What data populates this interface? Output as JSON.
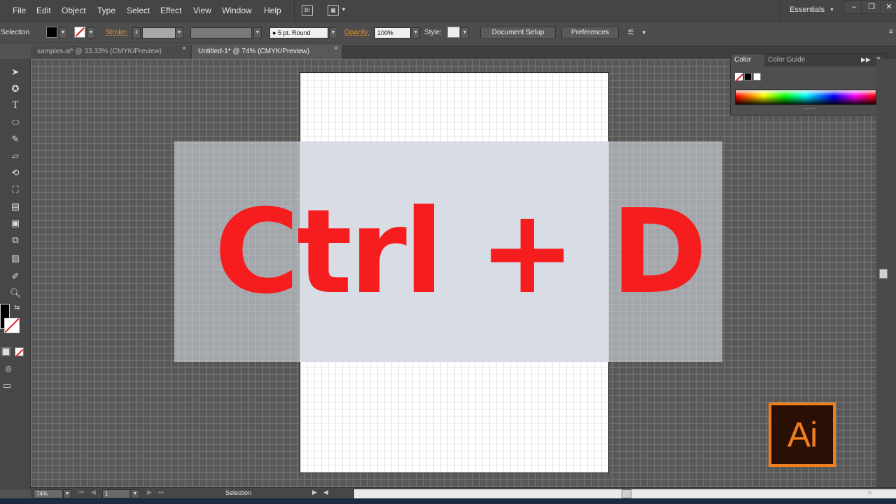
{
  "menu": {
    "items": [
      "File",
      "Edit",
      "Object",
      "Type",
      "Select",
      "Effect",
      "View",
      "Window",
      "Help"
    ],
    "workspace_label": "Essentials",
    "bridge_icon": "Br"
  },
  "control_bar": {
    "selection_label": "Selection",
    "stroke_label": "Stroke:",
    "brush_value": "5 pt. Round",
    "opacity_label": "Opacity:",
    "opacity_value": "100%",
    "style_label": "Style:",
    "document_setup_label": "Document Setup",
    "preferences_label": "Preferences"
  },
  "tabs": [
    {
      "label": "samples.ai* @ 33.33% (CMYK/Preview)",
      "active": false
    },
    {
      "label": "Untitled-1* @ 74% (CMYK/Preview)",
      "active": true
    }
  ],
  "tab_close_glyph": "×",
  "canvas": {
    "overlay_text": "Ctrl + D",
    "text_color": "#f51d1d",
    "overlay_color": "#d6dbe4"
  },
  "color_panel": {
    "tabs": [
      "Color",
      "Color Guide"
    ]
  },
  "status_bar": {
    "zoom": "74%",
    "artboard": "1",
    "tool": "Selection"
  },
  "logo": {
    "text": "Ai",
    "color": "#ef7e1e",
    "background": "#2a0f05"
  },
  "colors": {
    "accent_orange": "#e5902b",
    "ui_dark": "#454545"
  }
}
